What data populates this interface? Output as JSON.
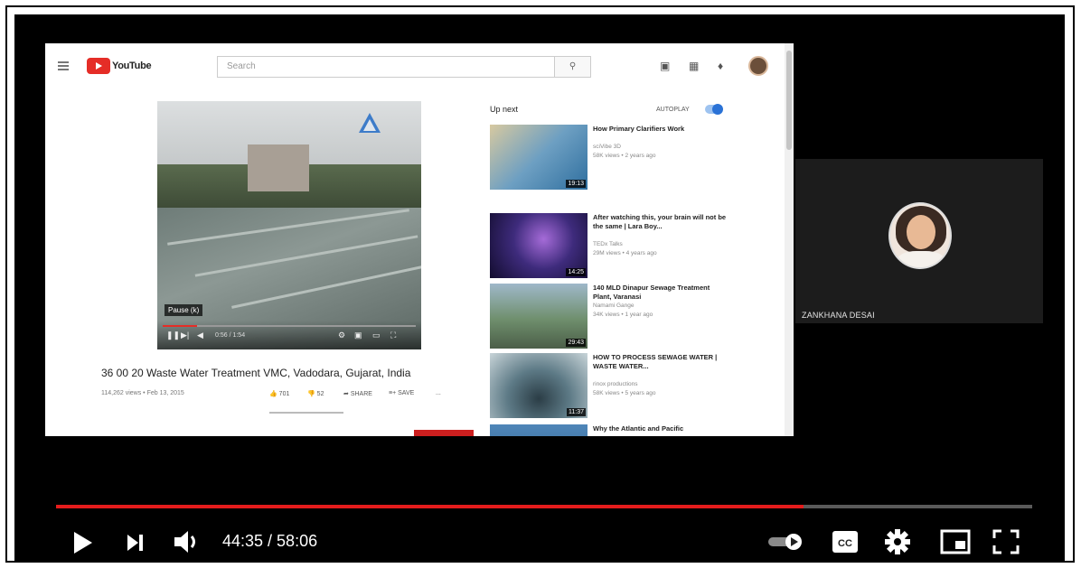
{
  "youtube": {
    "logo_text": "YouTube",
    "search_placeholder": "Search",
    "video": {
      "tooltip": "Pause (k)",
      "time": "0:56 / 1:54",
      "title": "36 00 20 Waste Water Treatment VMC, Vadodara, Gujarat, India",
      "meta": "114,262 views • Feb 13, 2015",
      "likes": "701",
      "dislikes": "52",
      "share": "SHARE",
      "save": "SAVE",
      "more": "..."
    },
    "up_next": {
      "label": "Up next",
      "autoplay": "AUTOPLAY",
      "autoplay_on": true,
      "items": [
        {
          "title": "How Primary Clarifiers Work",
          "channel": "sciVibe 3D",
          "meta": "58K views • 2 years ago",
          "duration": "19:13"
        },
        {
          "title": "After watching this, your brain will not be the same | Lara Boy...",
          "channel": "TEDx Talks",
          "meta": "29M views • 4 years ago",
          "duration": "14:25"
        },
        {
          "title": "140 MLD Dinapur Sewage Treatment Plant, Varanasi",
          "channel": "Namami Gange",
          "meta": "34K views • 1 year ago",
          "duration": "29:43"
        },
        {
          "title": "HOW TO PROCESS SEWAGE WATER | WASTE WATER...",
          "channel": "rinox productions",
          "meta": "58K views • 5 years ago",
          "duration": "11:37"
        },
        {
          "title": "Why the Atlantic and Pacific",
          "channel": "",
          "meta": "",
          "duration": ""
        }
      ]
    }
  },
  "participant": {
    "name": "ZANKHANA DESAI"
  },
  "player": {
    "progress_fraction": 0.766,
    "time": "44:35 / 58:06",
    "accent_color": "#e51c1c"
  }
}
